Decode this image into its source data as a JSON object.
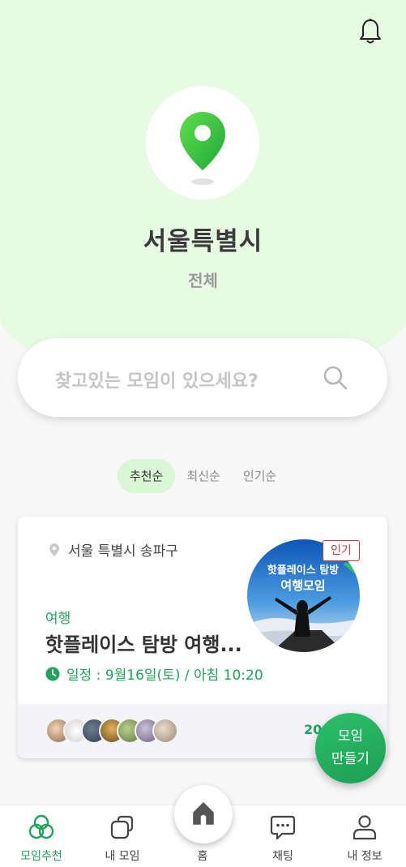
{
  "header": {
    "city": "서울특별시",
    "district": "전체"
  },
  "search": {
    "placeholder": "찾고있는 모임이 있으세요?"
  },
  "sort_tabs": [
    {
      "label": "추천순",
      "active": true
    },
    {
      "label": "최신순",
      "active": false
    },
    {
      "label": "인기순",
      "active": false
    }
  ],
  "meetup_card": {
    "location": "서울 특별시 송파구",
    "badge": "인기",
    "category": "여행",
    "title": "핫플레이스 탐방 여행...",
    "schedule": "일정 : 9월16일(토) / 아침 10:20",
    "thumbnail_text_line1": "핫플레이스 탐방",
    "thumbnail_text_line2": "여행모임",
    "member_count": "20"
  },
  "fab": {
    "line1": "모임",
    "line2": "만들기"
  },
  "bottom_nav": [
    {
      "label": "모임추천",
      "icon": "circles-icon",
      "active": true
    },
    {
      "label": "내 모임",
      "icon": "overlap-squares-icon",
      "active": false
    },
    {
      "label": "홈",
      "icon": "home-icon",
      "active": false
    },
    {
      "label": "채팅",
      "icon": "chat-bubble-icon",
      "active": false
    },
    {
      "label": "내 정보",
      "icon": "person-icon",
      "active": false
    }
  ],
  "colors": {
    "accent": "#22a35a",
    "hero_bg": "#e6fbe1",
    "badge_red": "#d23a3a"
  }
}
